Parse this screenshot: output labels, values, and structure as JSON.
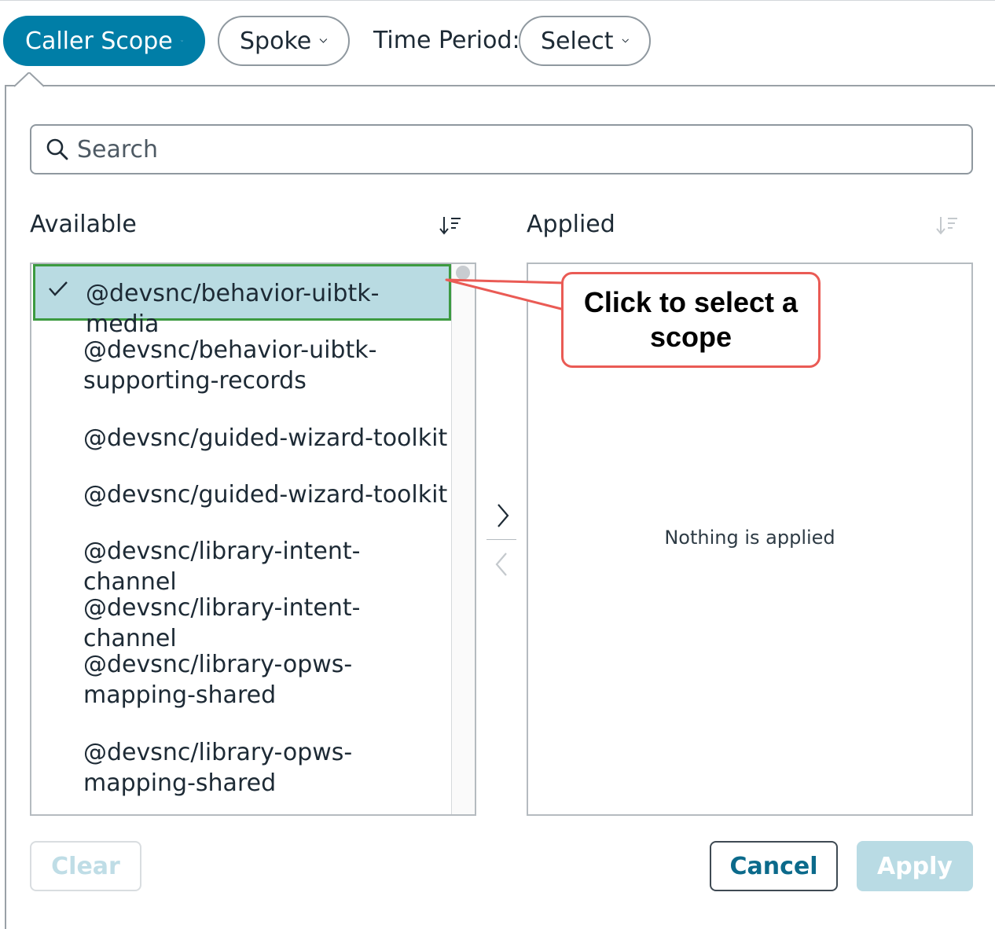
{
  "filters": {
    "caller_scope_label": "Caller Scope",
    "spoke_label": "Spoke",
    "time_period_label": "Time Period:",
    "time_period_value": "Select"
  },
  "search": {
    "placeholder": "Search"
  },
  "available": {
    "heading": "Available",
    "items": [
      {
        "label": "@devsnc/behavior-uibtk-media",
        "selected": true
      },
      {
        "label": "@devsnc/behavior-uibtk-supporting-records",
        "line1": "@devsnc/behavior-uibtk-",
        "line2": "supporting-records"
      },
      {
        "label": "@devsnc/guided-wizard-toolkit"
      },
      {
        "label": "@devsnc/guided-wizard-toolkit"
      },
      {
        "label": "@devsnc/library-intent-channel"
      },
      {
        "label": "@devsnc/library-intent-channel"
      },
      {
        "label": "@devsnc/library-opws-mapping-shared",
        "line1": "@devsnc/library-opws-",
        "line2": "mapping-shared"
      },
      {
        "label": "@devsnc/library-opws-mapping-shared",
        "line1": "@devsnc/library-opws-",
        "line2": "mapping-shared"
      }
    ]
  },
  "applied": {
    "heading": "Applied",
    "empty_message": "Nothing is applied"
  },
  "callout": {
    "line1": "Click to select a",
    "line2": "scope"
  },
  "actions": {
    "clear": "Clear",
    "cancel": "Cancel",
    "apply": "Apply"
  },
  "colors": {
    "accent": "#007ea7",
    "selected_bg": "#b9dbe2",
    "selected_border": "#3c9a40",
    "callout_border": "#ea5b55"
  }
}
